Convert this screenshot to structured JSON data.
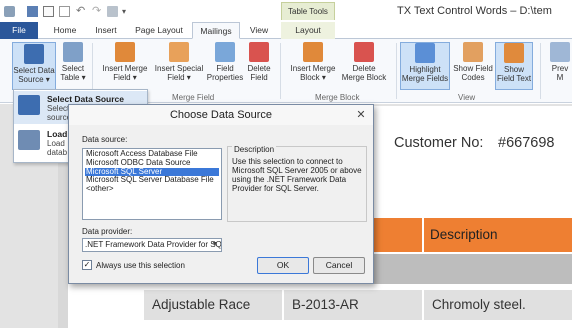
{
  "window": {
    "title": "TX Text Control Words – D:\\tem",
    "context_tab_label": "Table Tools"
  },
  "tabs": [
    {
      "label": "File"
    },
    {
      "label": "Home"
    },
    {
      "label": "Insert"
    },
    {
      "label": "Page Layout"
    },
    {
      "label": "Mailings"
    },
    {
      "label": "View"
    },
    {
      "label": "Layout"
    }
  ],
  "ribbon": {
    "buttons": {
      "select_data_source": "Select Data\nSource ▾",
      "select_table": "Select\nTable ▾",
      "insert_merge_field": "Insert Merge\nField ▾",
      "insert_special_field": "Insert Special\nField ▾",
      "field_properties": "Field\nProperties",
      "delete_field": "Delete\nField",
      "insert_merge_block": "Insert Merge\nBlock ▾",
      "delete_merge_block": "Delete\nMerge Block",
      "highlight_merge_fields": "Highlight\nMerge Fields",
      "show_field_codes": "Show Field\nCodes",
      "show_field_text": "Show\nField Text",
      "preview": "Prev\nM"
    },
    "groups": {
      "merge_field": "Merge Field",
      "merge_block": "Merge Block",
      "view": "View"
    }
  },
  "dropdown": {
    "items": [
      {
        "title": "Select Data Source",
        "desc": "Select\nsource"
      },
      {
        "title": "Load",
        "desc": "Load\ndatab"
      }
    ]
  },
  "document": {
    "customer_label": "Customer No:",
    "customer_value": "#667698",
    "header_description": "Description",
    "row": [
      "Adjustable Race",
      "B-2013-AR",
      "Chromoly steel."
    ]
  },
  "dialog": {
    "title": "Choose Data Source",
    "close_glyph": "✕",
    "data_source_label": "Data source:",
    "data_sources": [
      "Microsoft Access Database File",
      "Microsoft ODBC Data Source",
      "Microsoft SQL Server",
      "Microsoft SQL Server Database File",
      "<other>"
    ],
    "selected_index": 2,
    "description_title": "Description",
    "description_text": "Use this selection to connect to Microsoft SQL Server 2005 or above using the .NET Framework Data Provider for SQL Server.",
    "provider_label": "Data provider:",
    "provider_value": ".NET Framework Data Provider for SQ",
    "always_use_label": "Always use this selection",
    "always_use_checked": true,
    "ok_label": "OK",
    "cancel_label": "Cancel"
  },
  "colors": {
    "file_tab": "#2b579a",
    "orange_header": "#ee7f32",
    "selection_blue": "#3b78d8"
  }
}
